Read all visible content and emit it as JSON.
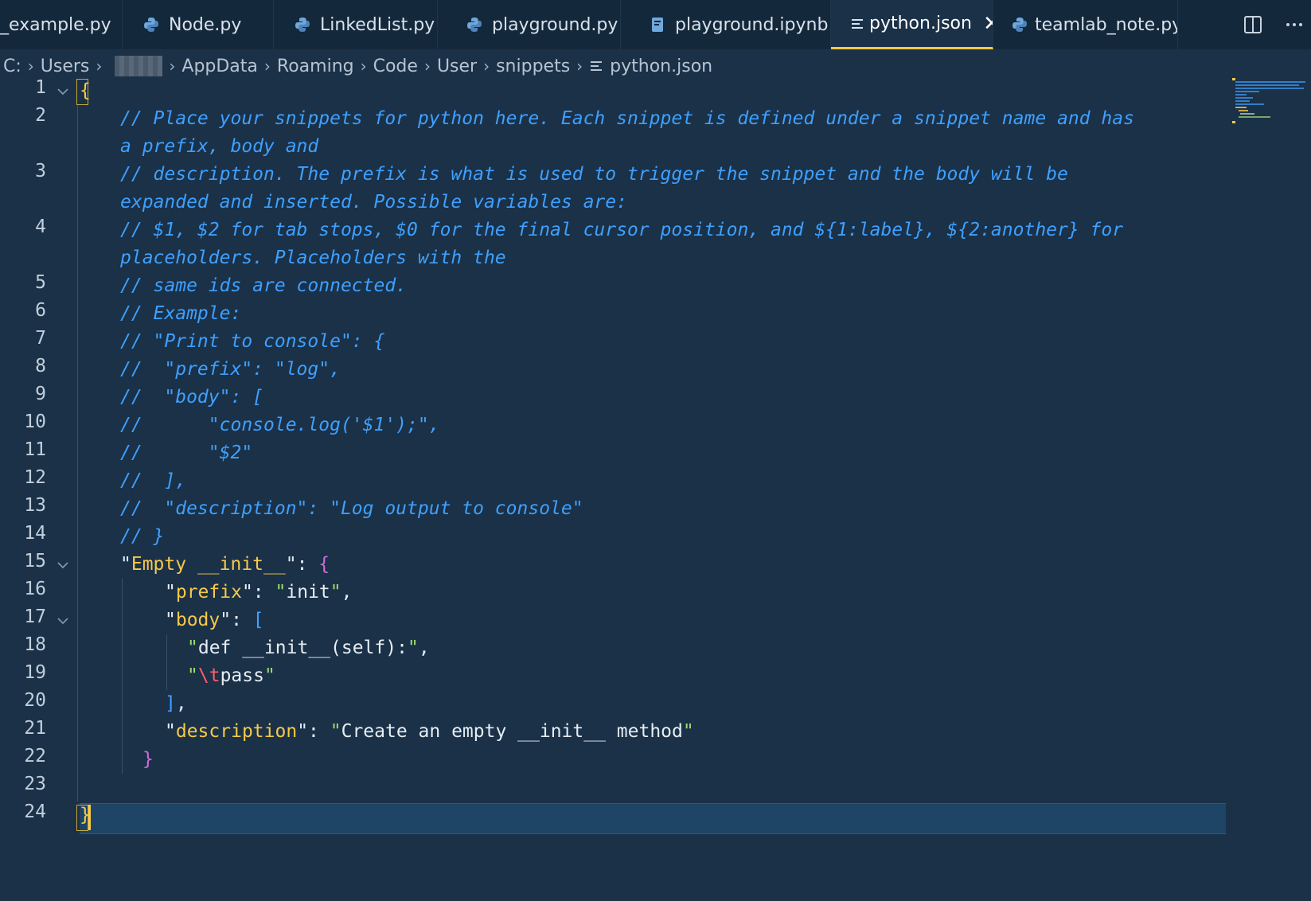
{
  "tabs": [
    {
      "label": "_example.py",
      "icon": "python-icon",
      "active": false
    },
    {
      "label": "Node.py",
      "icon": "python-icon",
      "active": false
    },
    {
      "label": "LinkedList.py",
      "icon": "python-icon",
      "active": false
    },
    {
      "label": "playground.py",
      "icon": "python-icon",
      "active": false
    },
    {
      "label": "playground.ipynb",
      "icon": "notebook-icon",
      "active": false
    },
    {
      "label": "python.json",
      "icon": "json-file-icon",
      "active": true
    },
    {
      "label": "teamlab_note.py",
      "icon": "python-icon",
      "active": false
    }
  ],
  "breadcrumb": {
    "items": [
      "C:",
      "Users",
      "",
      "AppData",
      "Roaming",
      "Code",
      "User",
      "snippets",
      "python.json"
    ]
  },
  "editor": {
    "line_numbers": [
      "1",
      "2",
      "3",
      "4",
      "5",
      "6",
      "7",
      "8",
      "9",
      "10",
      "11",
      "12",
      "13",
      "14",
      "15",
      "16",
      "17",
      "18",
      "19",
      "20",
      "21",
      "22",
      "23",
      "24"
    ],
    "lines": {
      "l1_brace": "{",
      "l2a": "// Place your snippets for python here. Each snippet is defined under a snippet name and has",
      "l2b": "a prefix, body and",
      "l3a": "// description. The prefix is what is used to trigger the snippet and the body will be",
      "l3b": "expanded and inserted. Possible variables are:",
      "l4a": "// $1, $2 for tab stops, $0 for the final cursor position, and ${1:label}, ${2:another} for",
      "l4b": "placeholders. Placeholders with the",
      "l5": "// same ids are connected.",
      "l6": "// Example:",
      "l7": "// \"Print to console\": {",
      "l8": "//  \"prefix\": \"log\",",
      "l9": "//  \"body\": [",
      "l10": "//      \"console.log('$1');\",",
      "l11": "//      \"$2\"",
      "l12": "//  ],",
      "l13": "//  \"description\": \"Log output to console\"",
      "l14": "// }",
      "l15_key": "Empty __init__",
      "l16_key": "prefix",
      "l16_val": "init",
      "l17_key": "body",
      "l18_val": "def __init__(self):",
      "l19_esc": "\\t",
      "l19_val": "pass",
      "l21_key": "description",
      "l21_val": "Create an empty __init__ method",
      "l24_brace": "}"
    }
  },
  "colors": {
    "background": "#1a3148",
    "comment": "#3fa0ff",
    "key": "#f7c948",
    "string_quote": "#9ddc6e",
    "accent_tab_border": "#f2c94c"
  }
}
